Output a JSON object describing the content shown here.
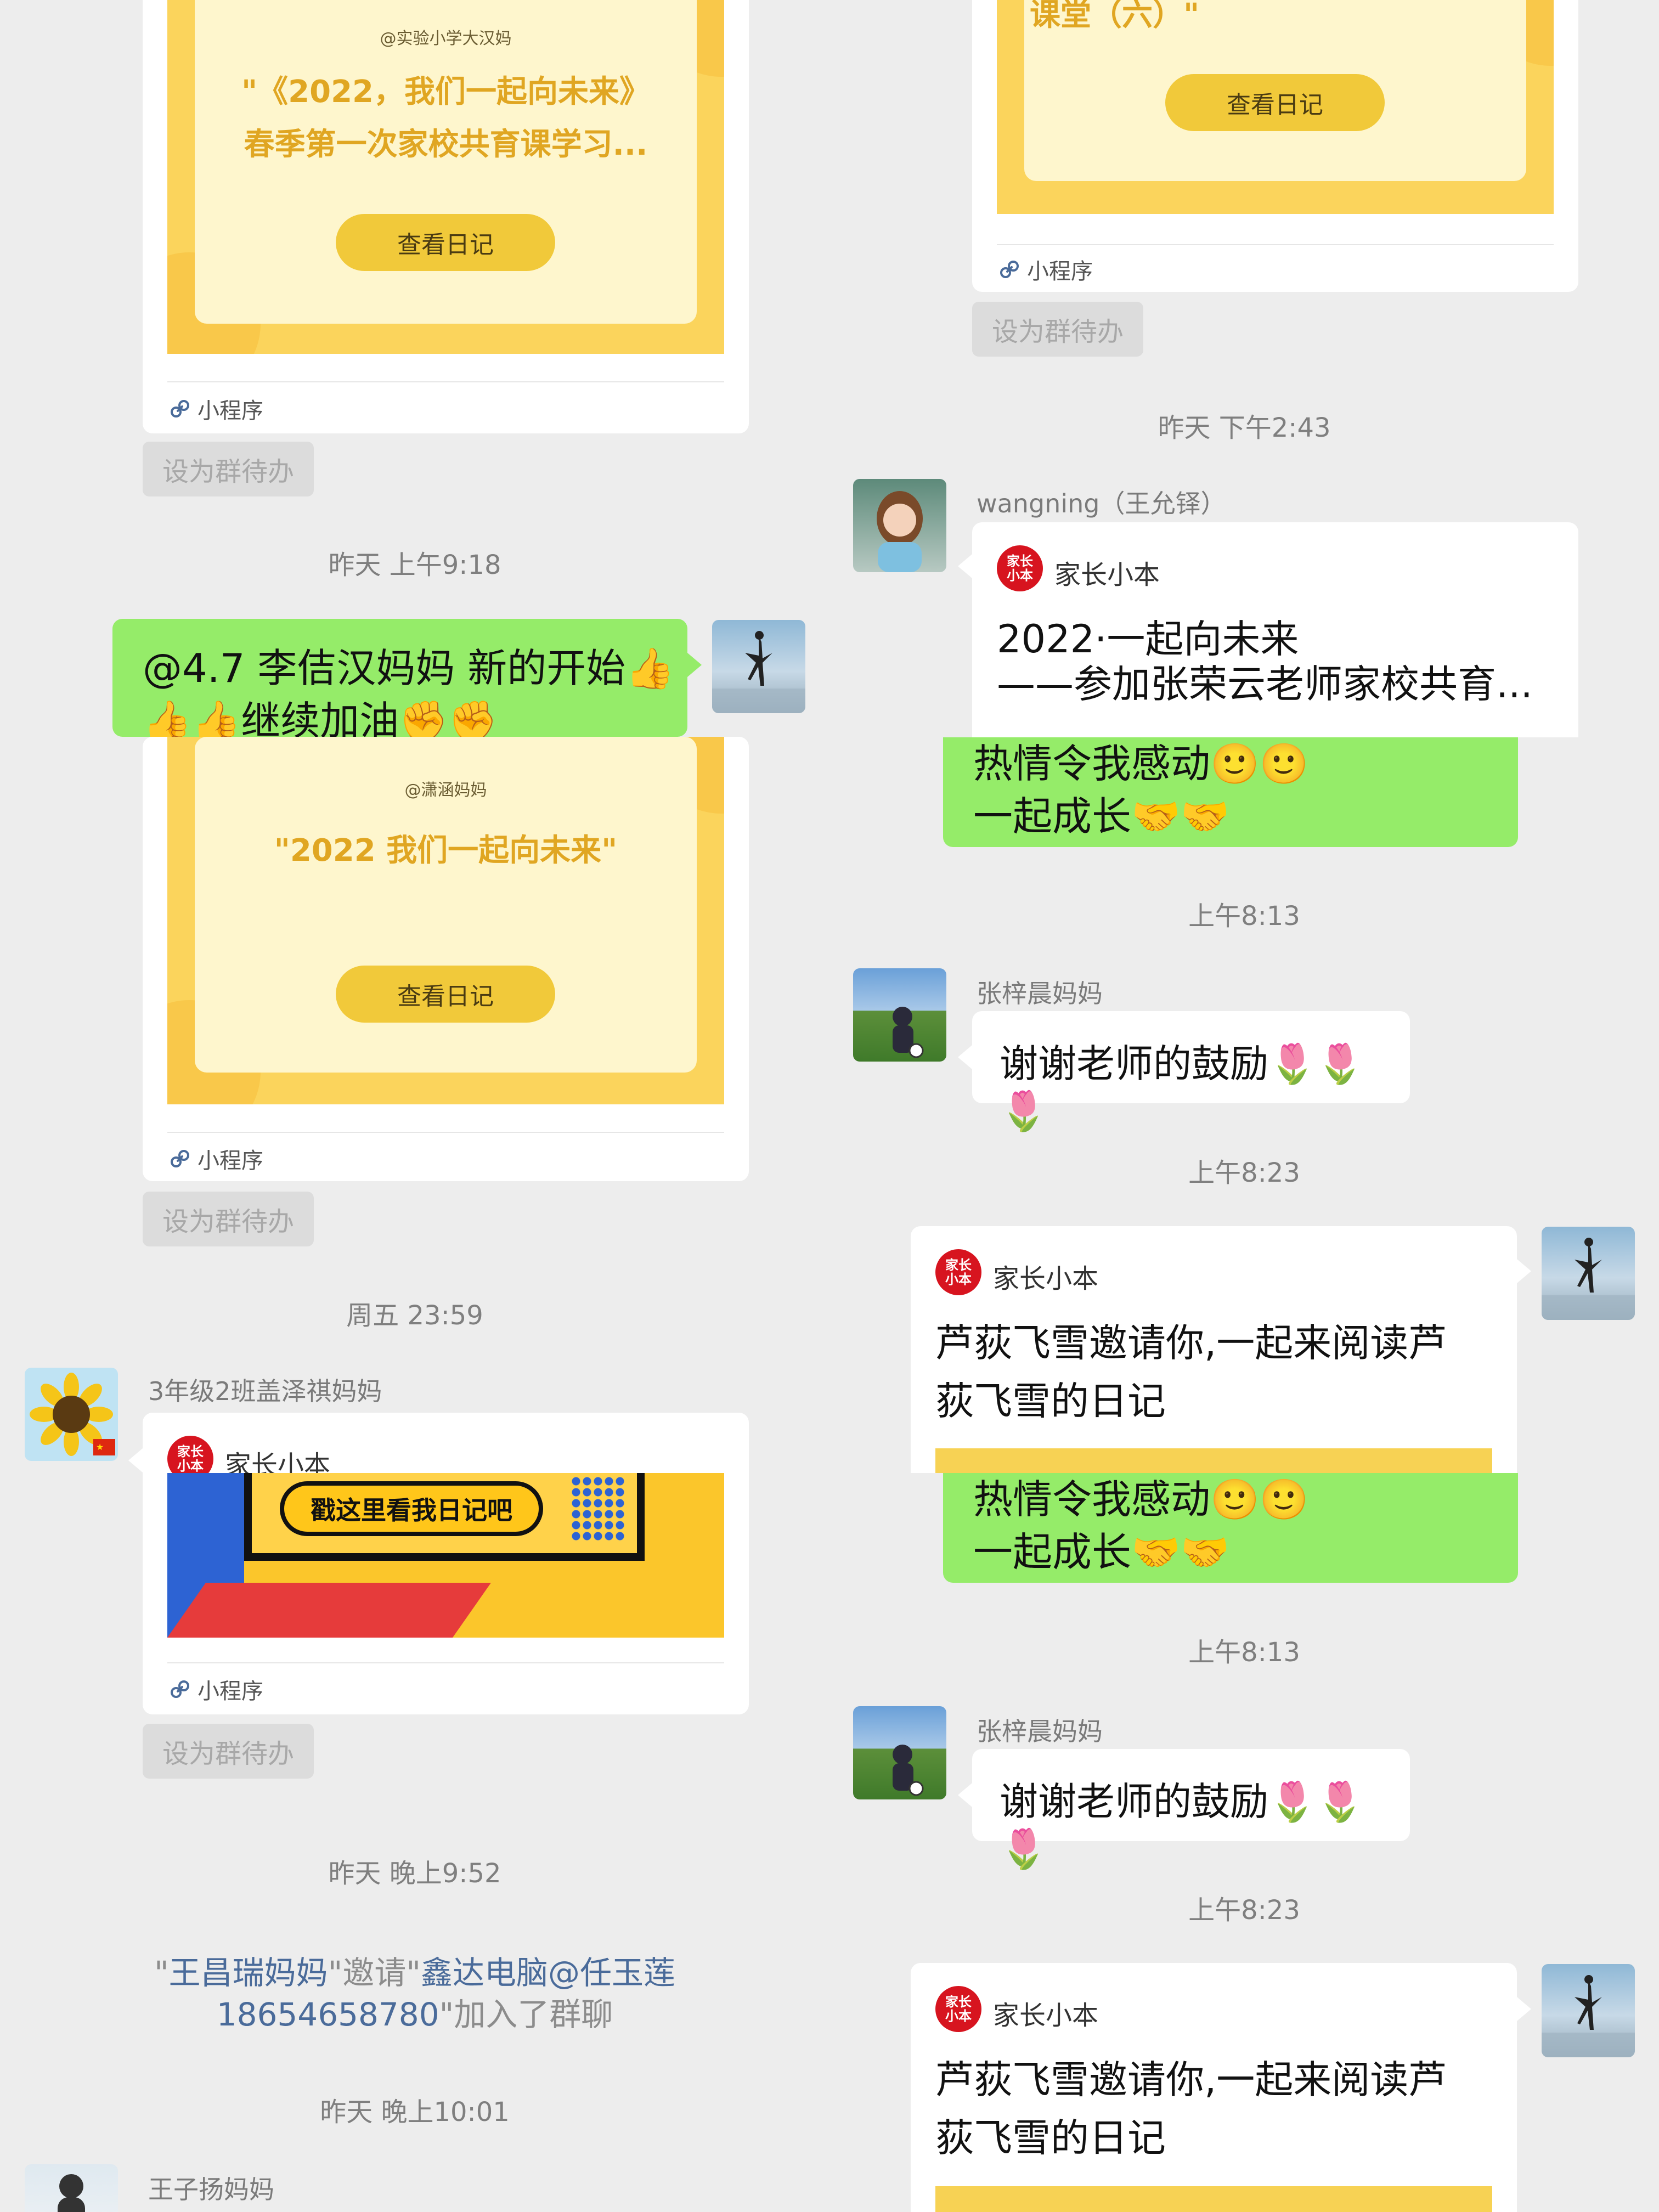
{
  "left": {
    "card1": {
      "author": "@实验小学大汉妈",
      "title_line1": "\"《2022，我们一起向未来》",
      "title_line2": "春季第一次家校共育课学习...",
      "button": "查看日记",
      "source": "小程序",
      "pending": "设为群待办"
    },
    "time1": "昨天 上午9:18",
    "msg1": {
      "line1": "@4.7 李佶汉妈妈  新的开始👍",
      "line2": "👍👍继续加油✊✊"
    },
    "card2": {
      "author": "@潇涵妈妈",
      "title": "\"2022   我们一起向未来\"",
      "button": "查看日记",
      "source": "小程序",
      "pending": "设为群待办"
    },
    "time2": "周五 23:59",
    "msg2": {
      "sender": "3年级2班盖泽祺妈妈",
      "app_name": "家长小本",
      "app_logo": "家长\n小本",
      "banner_text": "戳这里看我日记吧",
      "source": "小程序",
      "pending": "设为群待办"
    },
    "time3": "昨天 晚上9:52",
    "system": {
      "q1": "\"",
      "inviter": "王昌瑞妈妈",
      "q2": "\"邀请\"",
      "invitee1": "鑫达电脑@任玉莲",
      "invitee2": "18654658780",
      "tail": "\"加入了群聊"
    },
    "time4": "昨天 晚上10:01",
    "msg3": {
      "sender": "王子扬妈妈"
    }
  },
  "right": {
    "card1": {
      "title": "课堂（六）\"",
      "button": "查看日记",
      "source": "小程序",
      "pending": "设为群待办"
    },
    "time1": "昨天 下午2:43",
    "msg1": {
      "sender": "wangning（王允铎）",
      "app_name": "家长小本",
      "title1": "2022·一起向未来",
      "title2": "——参加张荣云老师家校共育..."
    },
    "green1": {
      "line1": "热情令我感动🙂🙂",
      "line2": "一起成长🤝🤝"
    },
    "time2": "上午8:13",
    "msg2": {
      "sender": "张梓晨妈妈",
      "text": "谢谢老师的鼓励🌷🌷🌷"
    },
    "time3": "上午8:23",
    "card2": {
      "app_name": "家长小本",
      "title1": "芦荻飞雪邀请你,一起来阅读芦",
      "title2": "荻飞雪的日记"
    },
    "green2": {
      "line1": "热情令我感动🙂🙂",
      "line2": "一起成长🤝🤝"
    },
    "time4": "上午8:13",
    "msg3": {
      "sender": "张梓晨妈妈",
      "text": "谢谢老师的鼓励🌷🌷🌷"
    },
    "time5": "上午8:23",
    "card3": {
      "app_name": "家长小本",
      "title1": "芦荻飞雪邀请你,一起来阅读芦",
      "title2": "荻飞雪的日记"
    }
  },
  "colors": {
    "bg": "#ededed",
    "green_bubble": "#95ec69",
    "poster_yellow": "#fbd45c",
    "poster_inner": "#fef6cd",
    "poster_title": "#e0a622",
    "button_yellow": "#f1c93a",
    "app_red": "#d7141f",
    "link_blue": "#4a6b9a"
  },
  "icons": [
    "link-icon",
    "app-logo-icon",
    "avatar"
  ]
}
